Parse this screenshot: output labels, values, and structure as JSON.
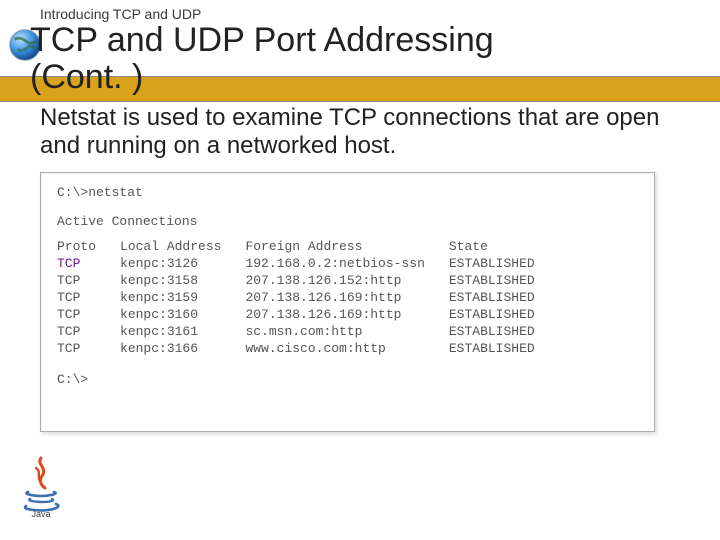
{
  "slide": {
    "kicker": "Introducing TCP and UDP",
    "title": "TCP and UDP Port Addressing\n(Cont. )",
    "body": "Netstat is used to examine TCP connections that are open and running on a networked host."
  },
  "terminal": {
    "prompt_cmd": "C:\\>netstat",
    "active_label": "Active Connections",
    "headers": {
      "proto": "Proto",
      "local": "Local Address",
      "foreign": "Foreign Address",
      "state": "State"
    },
    "rows": [
      {
        "proto": "TCP",
        "proto_highlight": true,
        "local": "kenpc:3126",
        "foreign": "192.168.0.2:netbios-ssn",
        "state": "ESTABLISHED"
      },
      {
        "proto": "TCP",
        "proto_highlight": false,
        "local": "kenpc:3158",
        "foreign": "207.138.126.152:http",
        "state": "ESTABLISHED"
      },
      {
        "proto": "TCP",
        "proto_highlight": false,
        "local": "kenpc:3159",
        "foreign": "207.138.126.169:http",
        "state": "ESTABLISHED"
      },
      {
        "proto": "TCP",
        "proto_highlight": false,
        "local": "kenpc:3160",
        "foreign": "207.138.126.169:http",
        "state": "ESTABLISHED"
      },
      {
        "proto": "TCP",
        "proto_highlight": false,
        "local": "kenpc:3161",
        "foreign": "sc.msn.com:http",
        "state": "ESTABLISHED"
      },
      {
        "proto": "TCP",
        "proto_highlight": false,
        "local": "kenpc:3166",
        "foreign": "www.cisco.com:http",
        "state": "ESTABLISHED"
      }
    ],
    "prompt_end": "C:\\>"
  },
  "logos": {
    "java_label": "Java"
  }
}
